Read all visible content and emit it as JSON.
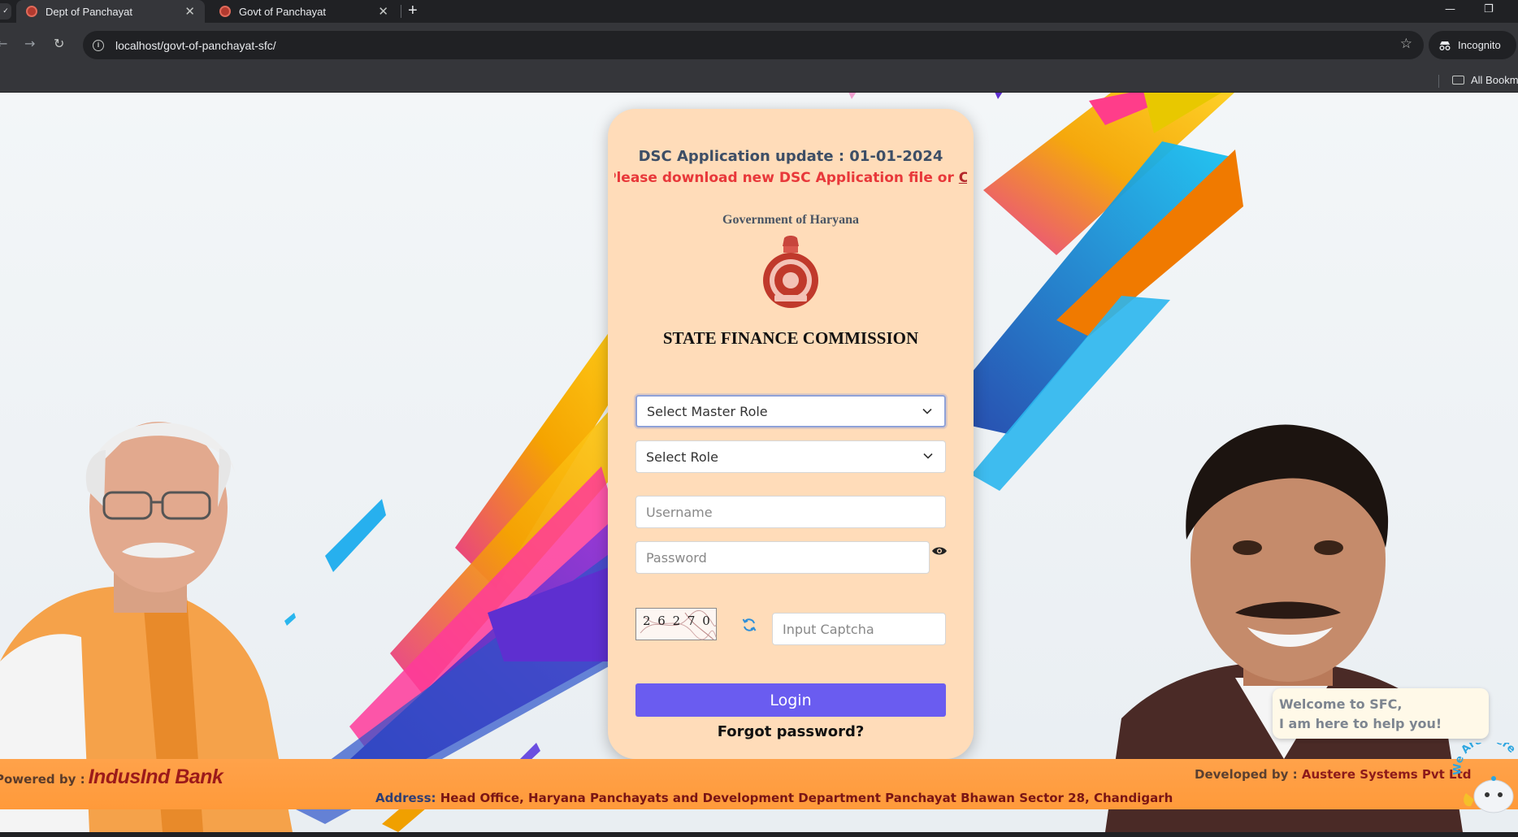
{
  "browser": {
    "tabs": [
      {
        "title": "Dept of Panchayat",
        "active": true
      },
      {
        "title": "Govt of Panchayat",
        "active": false
      }
    ],
    "url": "localhost/govt-of-panchayat-sfc/",
    "incognito_label": "Incognito",
    "bookmarks_label": "All Bookmarks",
    "edge_glyph": "✓"
  },
  "card": {
    "dsc_title": "DSC Application update : 01-01-2024",
    "marquee_text": "Please download new DSC Application file or ",
    "marquee_link": "Click here",
    "gov_title": "Government of Haryana",
    "sfc_title": "STATE FINANCE COMMISSION",
    "master_role_select": "Select Master Role",
    "role_select": "Select Role",
    "username_placeholder": "Username",
    "password_placeholder": "Password",
    "captcha_text": "2 6 2 7 0",
    "captcha_placeholder": "Input Captcha",
    "login_label": "Login",
    "forgot_label": "Forgot password?"
  },
  "footer": {
    "powered_label": "Powered by :",
    "bank_name": "IndusInd Bank",
    "developed_label": "Developed by :",
    "developed_value": " Austere Systems Pvt Ltd",
    "address_label": "Address:",
    "address_value": " Head Office, Haryana Panchayats and Development Department Panchayat Bhawan Sector 28, Chandigarh"
  },
  "chatbot": {
    "line1": "Welcome to SFC,",
    "line2": "I am here to help you!",
    "badge": "We Are Here"
  },
  "colors": {
    "card_bg": "#ffdcb9",
    "login_button": "#6a5cf0",
    "footer_band": "#ffa24a",
    "alert_text": "#e8383a"
  }
}
